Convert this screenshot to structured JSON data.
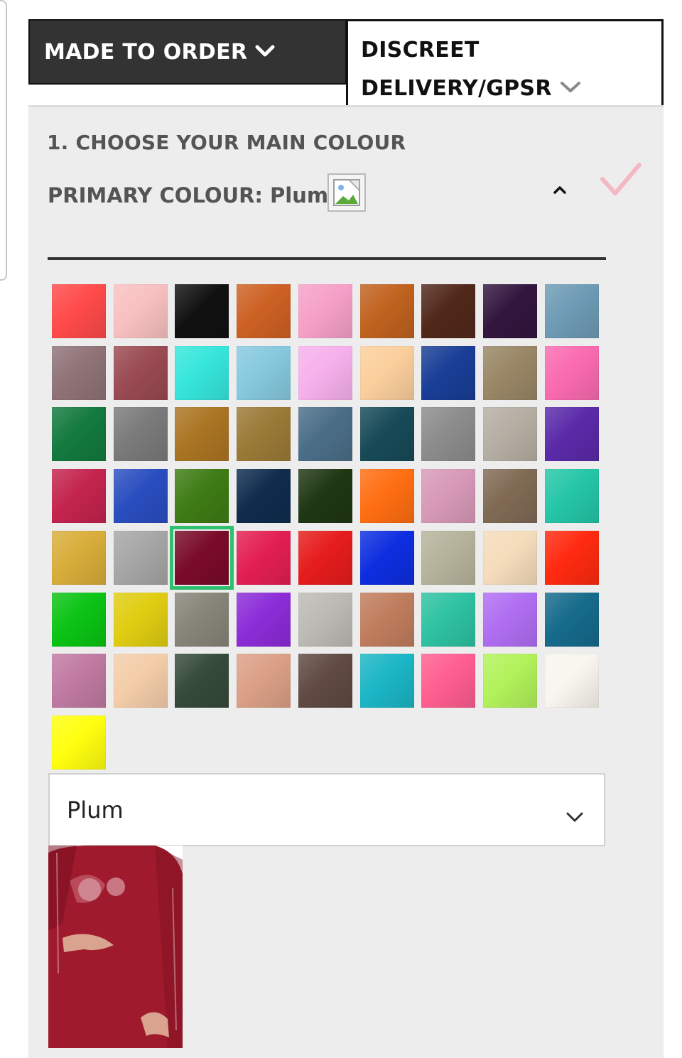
{
  "tabs": {
    "made_to_order": "MADE TO ORDER",
    "discreet_line1": "DISCREET",
    "discreet_line2": "DELIVERY/GPSR"
  },
  "step": {
    "title": "1. CHOOSE YOUR MAIN COLOUR",
    "primary_label": "PRIMARY COLOUR:",
    "primary_value": "Plum"
  },
  "icons": {
    "tab_chevron": "chevron-down-icon",
    "collapse": "chevron-up-icon",
    "check": "check-icon",
    "broken_image": "image-icon",
    "select_chevron": "chevron-down-icon"
  },
  "colors": {
    "accent_check": "#f4b8c2",
    "selected_outline": "#2fbf6e",
    "panel_bg": "#ededed",
    "tab_dark": "#333333"
  },
  "swatches": [
    "#ff4a4a",
    "#f8c0c0",
    "#111111",
    "#cd6124",
    "#f6a0c8",
    "#c0621f",
    "#51281a",
    "#33163e",
    "#6e9bb5",
    "#8f7377",
    "#9a4a52",
    "#36e6db",
    "#86c9de",
    "#f6b1ec",
    "#fbcf9c",
    "#193e96",
    "#998766",
    "#fa6bb0",
    "#137a3e",
    "#7a7a7a",
    "#aa7523",
    "#9b7a37",
    "#4b6e88",
    "#184a58",
    "#8c8c8c",
    "#b5aea3",
    "#5a2aa8",
    "#c4244e",
    "#2a4ec0",
    "#3e7c14",
    "#0f2c4e",
    "#1f3712",
    "#ff6e12",
    "#d799b8",
    "#806a54",
    "#25c6a8",
    "#d8ad3a",
    "#a6a6a6",
    "#7a0b2a",
    "#e31f52",
    "#e61c1c",
    "#0d2ee0",
    "#b6b39c",
    "#f5dcbb",
    "#ff2a10",
    "#0bc414",
    "#e0cd12",
    "#878579",
    "#8c2cd8",
    "#bcbab4",
    "#c07d5e",
    "#2ec2a2",
    "#b06ef2",
    "#166b8c",
    "#c07aa2",
    "#f4cda9",
    "#354a3a",
    "#dba086",
    "#604a42",
    "#1bb6c6",
    "#ff5e90",
    "#b2f25a",
    "#f8f6ee",
    "#ffff10"
  ],
  "selected_swatch": 38,
  "select": {
    "value": "Plum"
  },
  "preview": {
    "suit_color": "#a01a2e"
  }
}
